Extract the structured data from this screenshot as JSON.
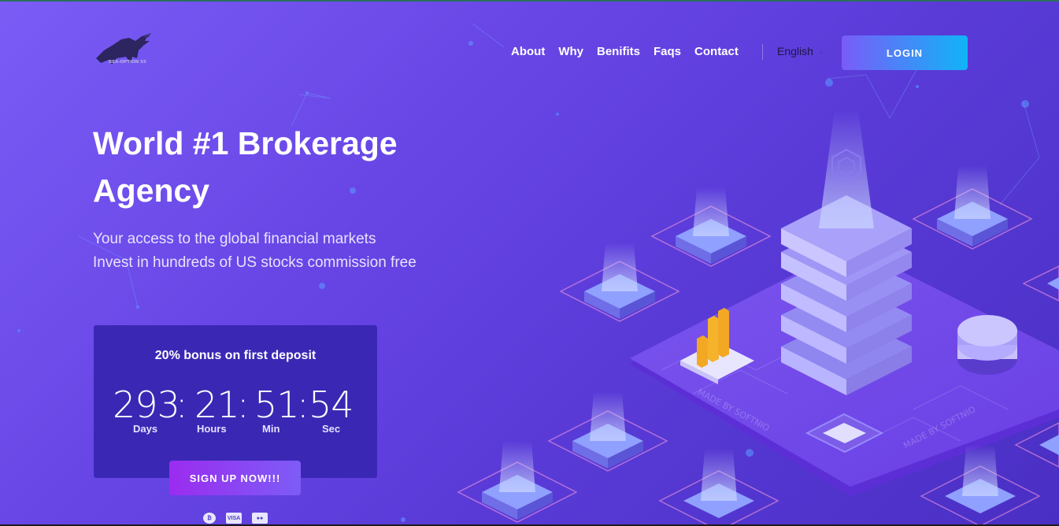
{
  "brand": {
    "logo_text": "BEA-OPTION 55"
  },
  "nav": {
    "items": [
      {
        "label": "About"
      },
      {
        "label": "Why"
      },
      {
        "label": "Benifits"
      },
      {
        "label": "Faqs"
      },
      {
        "label": "Contact"
      }
    ],
    "language": "English",
    "login_label": "LOGIN"
  },
  "hero": {
    "title": "World #1 Brokerage Agency",
    "subtitle_line1": "Your access to the global financial markets",
    "subtitle_line2": "Invest in hundreds of US stocks commission free"
  },
  "countdown": {
    "title": "20% bonus on first deposit",
    "days": "293",
    "hours": "21",
    "minutes": "51",
    "seconds": "54",
    "days_label": "Days",
    "hours_label": "Hours",
    "min_label": "Min",
    "sec_label": "Sec",
    "separator": ":"
  },
  "cta": {
    "signup_label": "SIGN UP NOW!!!"
  },
  "payments": {
    "btc": "₿",
    "visa": "VISA",
    "mc": "●●"
  },
  "illustration": {
    "watermark": "MADE BY SOFTNIO"
  },
  "colors": {
    "bg_start": "#7b5cf5",
    "bg_end": "#4a2fc4",
    "countdown_bg": "#3a28b4",
    "login_gradient_start": "#7a5cf8",
    "login_gradient_end": "#10b4f7",
    "signup_gradient_start": "#9b2cf0",
    "signup_gradient_end": "#7d5cf6"
  }
}
